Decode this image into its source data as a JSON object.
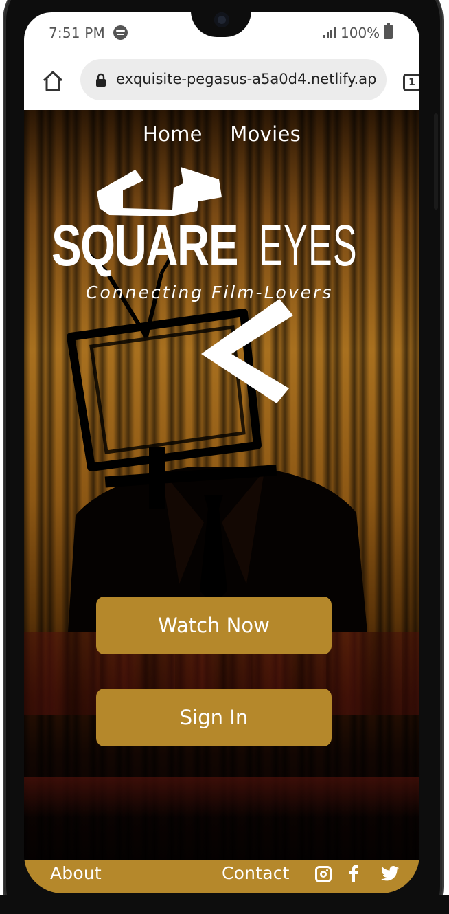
{
  "status_bar": {
    "time": "7:51 PM",
    "battery": "100%",
    "icons": [
      "spotify-icon",
      "signal-icon",
      "battery-icon"
    ]
  },
  "browser": {
    "url": "exquisite-pegasus-a5a0d4.netlify.ap",
    "tab_count": "1",
    "icons": [
      "home-icon",
      "lock-icon",
      "tabs-icon"
    ]
  },
  "nav": {
    "items": [
      {
        "label": "Home"
      },
      {
        "label": "Movies"
      }
    ]
  },
  "logo": {
    "word1": "SQUARE",
    "word2": "EYES",
    "tagline": "Connecting Film-Lovers"
  },
  "buttons": {
    "watch_now": "Watch Now",
    "sign_in": "Sign In"
  },
  "footer": {
    "about": "About",
    "contact": "Contact",
    "social_icons": [
      "instagram-icon",
      "facebook-icon",
      "twitter-icon"
    ]
  },
  "colors": {
    "accent_gold": "#b5882b",
    "text_white": "#ffffff",
    "curtain_dark": "#2a1604"
  }
}
